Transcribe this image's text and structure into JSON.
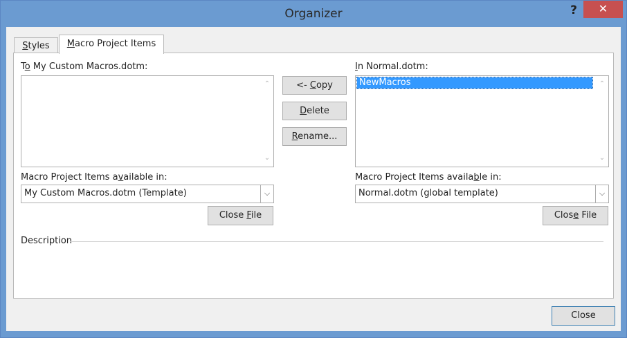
{
  "window": {
    "title": "Organizer",
    "help": "?",
    "close": "✕"
  },
  "tabs": [
    {
      "label_pre": "",
      "label_u": "S",
      "label_post": "tyles",
      "selected": false
    },
    {
      "label_pre": "",
      "label_u": "M",
      "label_post": "acro Project Items",
      "selected": true
    }
  ],
  "left": {
    "list_label_pre": "T",
    "list_label_u": "o",
    "list_label_post": " My Custom Macros.dotm:",
    "items": [],
    "available_label_pre": "Macro Project Items a",
    "available_label_u": "v",
    "available_label_post": "ailable in:",
    "combo_value": "My Custom Macros.dotm (Template)",
    "close_file_pre": "Close ",
    "close_file_u": "F",
    "close_file_post": "ile"
  },
  "right": {
    "list_label_pre": "",
    "list_label_u": "I",
    "list_label_post": "n Normal.dotm:",
    "items": [
      "NewMacros"
    ],
    "available_label_pre": "Macro Project Items availa",
    "available_label_u": "b",
    "available_label_post": "le in:",
    "combo_value": "Normal.dotm (global template)",
    "close_file_pre": "Clos",
    "close_file_u": "e",
    "close_file_post": " File"
  },
  "middle": {
    "copy_pre": "<- ",
    "copy_u": "C",
    "copy_post": "opy",
    "delete_pre": "",
    "delete_u": "D",
    "delete_post": "elete",
    "rename_pre": "",
    "rename_u": "R",
    "rename_post": "ename..."
  },
  "description_label": "Description",
  "footer": {
    "close_label": "Close"
  },
  "colors": {
    "titlebar": "#6b9bd1",
    "close_button": "#c75050",
    "selection": "#3399ff",
    "dialog_bg": "#f0f0f0"
  }
}
